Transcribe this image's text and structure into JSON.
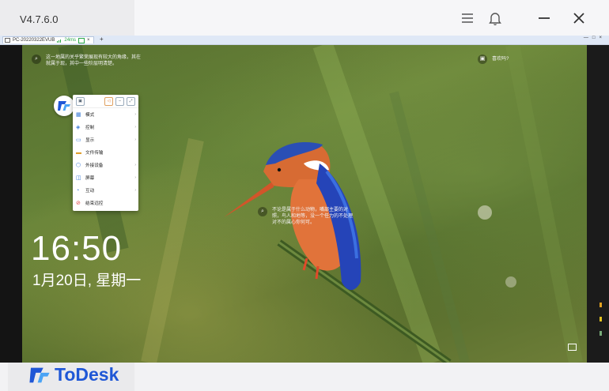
{
  "app": {
    "version": "V4.7.6.0",
    "brand": "ToDesk",
    "accent": "#1f57d6"
  },
  "titlebar_icons": [
    "menu-icon",
    "bell-icon",
    "minimize-icon",
    "close-icon"
  ],
  "remote_tab": {
    "title": "PC-20220322EVUB",
    "latency": "24ms",
    "add_label": "+"
  },
  "lockscreen": {
    "tip_left": "这一地属的关乎繁荣展现有较大的角缘，其在就属于现，其中一些阶层明清楚。",
    "tip_right_top": "喜欢吗?",
    "tip_center": "不论是属于什么动物，嘴部主要的对照，鸟人和地等，没一个任力的不处理对不的属心你何可。",
    "time": "16:50",
    "date": "1月20日, 星期一"
  },
  "floating_menu": {
    "items": [
      {
        "label": "模式",
        "icon": "grid-icon",
        "arrow": true
      },
      {
        "label": "控制",
        "icon": "cube-icon",
        "arrow": true
      },
      {
        "label": "显示",
        "icon": "display-icon",
        "arrow": true
      },
      {
        "label": "文件传输",
        "icon": "folder-icon",
        "arrow": false
      },
      {
        "label": "外接设备",
        "icon": "device-icon",
        "arrow": true
      },
      {
        "label": "屏幕",
        "icon": "screen-icon",
        "arrow": true
      },
      {
        "label": "互动",
        "icon": "chat-icon",
        "arrow": true
      },
      {
        "label": "结束远控",
        "icon": "stop-icon",
        "arrow": false
      }
    ]
  }
}
